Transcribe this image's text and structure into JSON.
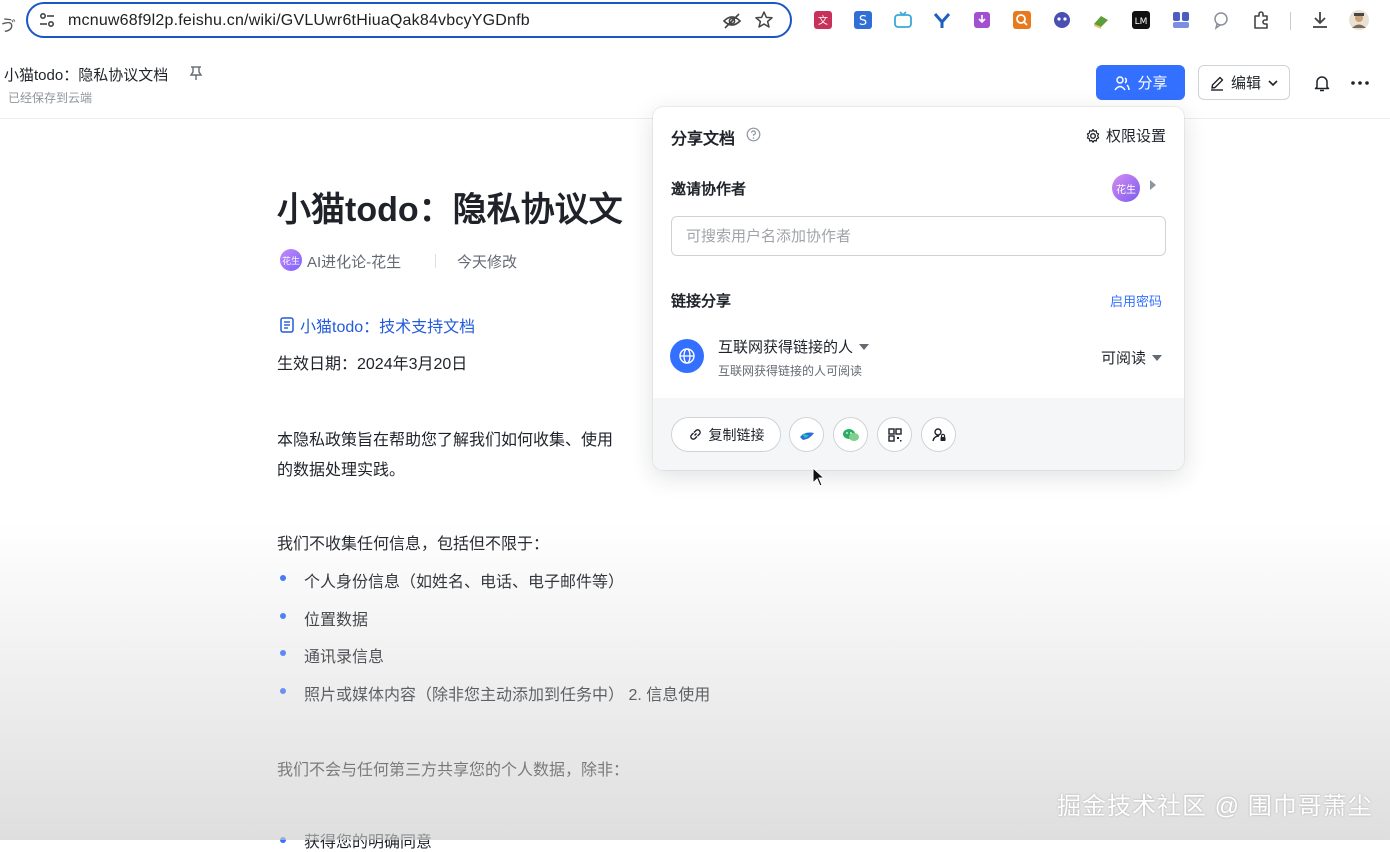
{
  "browser": {
    "url": "mcnuw68f9l2p.feishu.cn/wiki/GVLUwr6tHiuaQak84vbcyYGDnfb",
    "left_edge_glyph": "ゔ",
    "extensions": [
      {
        "name": "translate-ext-icon",
        "color": "#c8325a"
      },
      {
        "name": "s-ext-icon",
        "color": "#2f6fd6"
      },
      {
        "name": "tv-ext-icon",
        "color": "#3aa7d9"
      },
      {
        "name": "y-ext-icon",
        "color": "#1f5fbf"
      },
      {
        "name": "download-purple-ext-icon",
        "color": "#a24fd0"
      },
      {
        "name": "search-orange-ext-icon",
        "color": "#e8791d"
      },
      {
        "name": "face-ext-icon",
        "color": "#4a4fb3"
      },
      {
        "name": "book-ext-icon",
        "color": "#5e9e3a"
      },
      {
        "name": "lm-ext-icon",
        "color": "#111111"
      },
      {
        "name": "grid-ext-icon",
        "color": "#4a5fc1"
      },
      {
        "name": "chat-ext-icon",
        "color": "#8a8f98"
      }
    ]
  },
  "header": {
    "doc_title": "小猫todo：隐私协议文档",
    "saved_status": "已经保存到云端",
    "share_label": "分享",
    "edit_label": "编辑"
  },
  "document": {
    "title": "小猫todo：隐私协议文",
    "author_avatar": "花生",
    "author": "AI进化论-花生",
    "modified": "今天修改",
    "linked_doc": "小猫todo：技术支持文档",
    "effective_date": "生效日期：2024年3月20日",
    "intro_line1": "本隐私政策旨在帮助您了解我们如何收集、使用",
    "intro_line2": "的数据处理实践。",
    "collect_intro": "我们不收集任何信息，包括但不限于：",
    "collect_items": [
      "个人身份信息（如姓名、电话、电子邮件等）",
      "位置数据",
      "通讯录信息",
      "照片或媒体内容（除非您主动添加到任务中） 2. 信息使用"
    ],
    "share_intro": "我们不会与任何第三方共享您的个人数据，除非：",
    "share_item_cut": "获得您的明确同意"
  },
  "share_panel": {
    "title": "分享文档",
    "permission_settings": "权限设置",
    "invite_label": "邀请协作者",
    "invite_avatar": "花生",
    "search_placeholder": "可搜索用户名添加协作者",
    "search_value": "",
    "link_share_label": "链接分享",
    "enable_password": "启用密码",
    "scope_title": "互联网获得链接的人",
    "scope_desc": "互联网获得链接的人可阅读",
    "access_level": "可阅读",
    "copy_link": "复制链接"
  },
  "watermark": "掘金技术社区 @ 围巾哥萧尘",
  "colors": {
    "accent": "#3370ff",
    "link": "#245bdb",
    "url_border": "#1a56c4"
  }
}
